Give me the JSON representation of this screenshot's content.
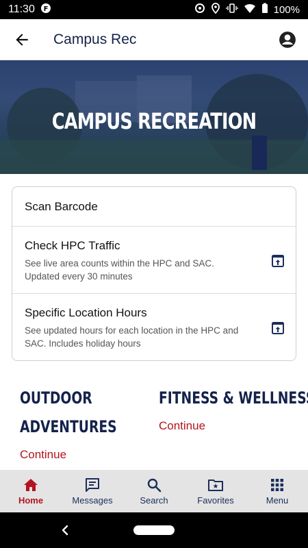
{
  "status_bar": {
    "time": "11:30",
    "battery": "100%"
  },
  "app_bar": {
    "title": "Campus Rec"
  },
  "hero": {
    "title": "CAMPUS RECREATION"
  },
  "card": {
    "rows": [
      {
        "title": "Scan Barcode"
      },
      {
        "title": "Check HPC Traffic",
        "desc": "See live area counts within the HPC and SAC. Updated every 30 minutes"
      },
      {
        "title": "Specific Location Hours",
        "desc": "See updated hours for each location in the HPC and SAC. Includes holiday hours"
      }
    ]
  },
  "tiles": [
    {
      "title_line1": "OUTDOOR",
      "title_line2": "ADVENTURES",
      "link": "Continue"
    },
    {
      "title_line1": "FITNESS & WELLNESS",
      "link": "Continue"
    }
  ],
  "tab_bar": {
    "tabs": [
      {
        "label": "Home",
        "icon": "home-icon",
        "active": true
      },
      {
        "label": "Messages",
        "icon": "message-icon",
        "active": false
      },
      {
        "label": "Search",
        "icon": "search-icon",
        "active": false
      },
      {
        "label": "Favorites",
        "icon": "favorites-folder-icon",
        "active": false
      },
      {
        "label": "Menu",
        "icon": "grid-menu-icon",
        "active": false
      }
    ]
  },
  "colors": {
    "navy": "#14224b",
    "accent_red": "#b3141f",
    "tab_bar_bg": "#e4e4e4"
  }
}
